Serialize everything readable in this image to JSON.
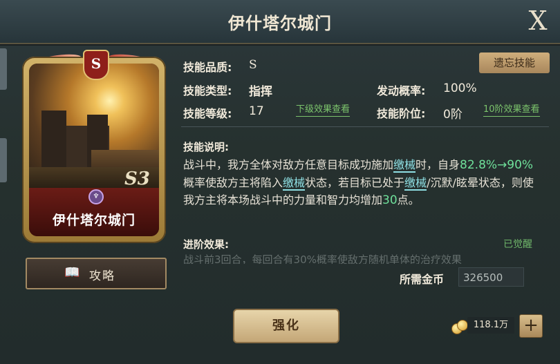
{
  "window": {
    "title": "伊什塔尔城门",
    "close_label": "X"
  },
  "card": {
    "name": "伊什塔尔城门",
    "quality_badge": "S",
    "code": "S3",
    "gem_glyph": "♆"
  },
  "guide": {
    "label": "攻略",
    "icon": "book-icon",
    "glyph": "📖"
  },
  "skill": {
    "quality_label": "技能品质:",
    "quality_value": "S",
    "type_label": "技能类型:",
    "type_value": "指挥",
    "level_label": "技能等级:",
    "level_value": "17",
    "next_level_link": "下级效果查看",
    "trigger_label": "发动概率:",
    "trigger_value": "100%",
    "stage_label": "技能阶位:",
    "stage_value": "0阶",
    "stage10_link": "10阶效果查看",
    "forget_button": "遗忘技能"
  },
  "description": {
    "label": "技能说明:",
    "p1": "战斗中，我方全体对敌方任意目标成功施加",
    "kw1": "缴械",
    "p2": "时，自身",
    "rate": "82.8%→90%",
    "p3": "概率使敌方主将陷入",
    "kw2": "缴械",
    "p4": "状态，若目标已处于",
    "kw3": "缴械",
    "p5": "/沉默/眩晕状态，则使我方主将本场战斗中的力量和智力均增加",
    "bonus": "30",
    "p6": "点。"
  },
  "advance": {
    "label": "进阶效果:",
    "status": "已觉醒",
    "faded_text": "战斗前3回合，每回合有30%概率使敌方随机单体的治疗效果"
  },
  "cost": {
    "label": "所需金币",
    "value": "326500"
  },
  "enhance_button": "强化",
  "currency": {
    "amount": "118.1万",
    "plus_label": "+",
    "icon": "gold-coins-icon"
  },
  "colors": {
    "keyword": "#8fe0e4",
    "number": "#6fe09a",
    "link": "#7cc46c",
    "button_gold": "#c4a777",
    "card_red": "#6b1c16"
  }
}
